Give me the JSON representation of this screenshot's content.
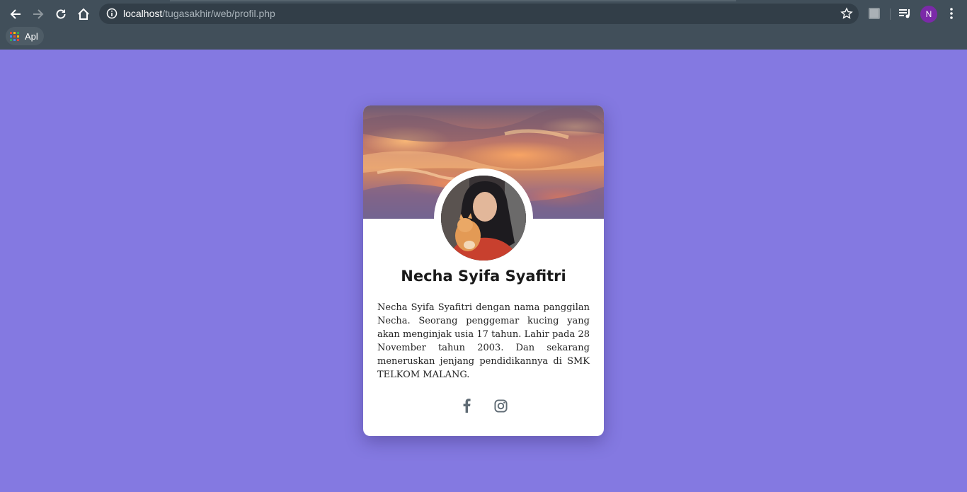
{
  "browser": {
    "url_host": "localhost",
    "url_path": "/tugasakhir/web/profil.php",
    "profile_initial": "N",
    "bookmarks": [
      {
        "label": "Apl"
      }
    ]
  },
  "profile": {
    "name": "Necha Syifa Syafitri",
    "bio": "Necha Syifa Syafitri dengan nama panggilan Necha. Seorang penggemar kucing yang akan menginjak usia 17 tahun. Lahir pada 28 November tahun 2003. Dan sekarang meneruskan jenjang pendidikannya di SMK TELKOM MALANG.",
    "socials": [
      {
        "icon": "facebook-icon"
      },
      {
        "icon": "instagram-icon"
      }
    ]
  },
  "colors": {
    "page_background": "#8479e1",
    "chrome_background": "#414f5a",
    "omnibox_background": "#323e48",
    "avatar_profile": "#7b2aa8",
    "social_icon": "#5f6b74"
  }
}
